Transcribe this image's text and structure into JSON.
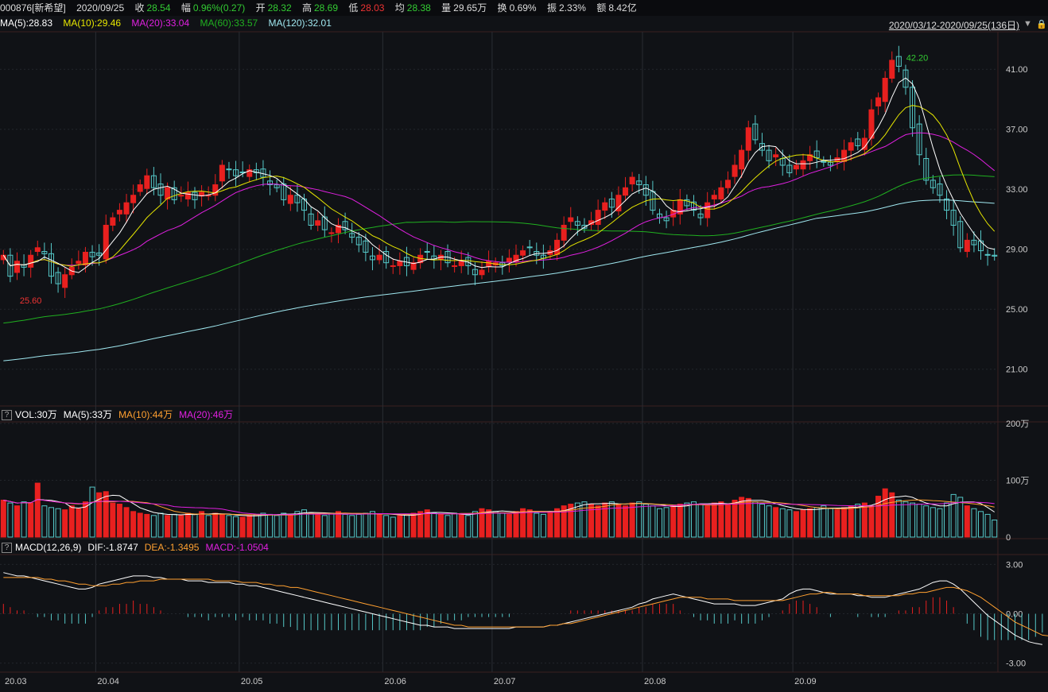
{
  "header": {
    "code_name": "000876[新希望]",
    "date": "2020/09/25",
    "close_label": "收",
    "close": "28.54",
    "change_label": "幅",
    "change": "0.96%(0.27)",
    "open_label": "开",
    "open": "28.32",
    "high_label": "高",
    "high": "28.69",
    "low_label": "低",
    "low": "28.03",
    "avg_label": "均",
    "avg": "28.38",
    "volume_label": "量",
    "volume": "29.65万",
    "turnover_label": "换",
    "turnover": "0.69%",
    "amplitude_label": "振",
    "amplitude": "2.33%",
    "amount_label": "额",
    "amount": "8.42亿"
  },
  "ma_legend": {
    "ma5": "MA(5):28.83",
    "ma10": "MA(10):29.46",
    "ma20": "MA(20):33.04",
    "ma60": "MA(60):33.57",
    "ma120": "MA(120):32.01"
  },
  "range_label": "2020/03/12-2020/09/25(136日)",
  "icons": [
    "dropdown-icon",
    "lock-icon"
  ],
  "vol_legend": {
    "help": "?",
    "vol": "VOL:30万",
    "ma5": "MA(5):33万",
    "ma10": "MA(10):44万",
    "ma20": "MA(20):46万"
  },
  "macd_legend": {
    "help": "?",
    "name": "MACD(12,26,9)",
    "dif": "DIF:-1.8747",
    "dea": "DEA:-1.3495",
    "macd": "MACD:-1.0504"
  },
  "colors": {
    "up": "#e8201f",
    "down": "#55c8c8",
    "ma5": "#ffffff",
    "ma10": "#e6e600",
    "ma20": "#e020e0",
    "ma60": "#20b020",
    "ma120": "#a0e8f0",
    "dif": "#ffffff",
    "dea": "#ffa030"
  },
  "chart_data": [
    {
      "type": "candlestick",
      "y_ticks": [
        "41.00",
        "37.00",
        "33.00",
        "29.00",
        "25.00",
        "21.00"
      ],
      "ylim": [
        19.5,
        43.5
      ],
      "max_label": "42.20",
      "min_label": "25.60",
      "x_ticks": [
        "20.03",
        "20.04",
        "20.05",
        "20.06",
        "20.07",
        "20.08",
        "20.09"
      ],
      "close": [
        28.6,
        27.2,
        28.2,
        27.8,
        28.6,
        29.1,
        28.7,
        27.2,
        26.7,
        27.3,
        27.8,
        28.2,
        28.8,
        28.5,
        28.6,
        30.6,
        31.1,
        31.6,
        32.1,
        32.6,
        33.3,
        33.9,
        33.1,
        32.6,
        33.1,
        32.3,
        32.6,
        32.8,
        32.3,
        32.8,
        32.6,
        33.3,
        34.6,
        34.3,
        33.9,
        34.1,
        34.3,
        34.1,
        33.8,
        33.3,
        33.1,
        32.3,
        32.6,
        32.1,
        31.6,
        30.6,
        30.9,
        30.3,
        30.1,
        30.6,
        30.3,
        29.8,
        29.3,
        28.8,
        28.3,
        28.6,
        28.1,
        27.9,
        28.2,
        27.9,
        28.1,
        28.6,
        28.8,
        28.3,
        28.6,
        28.1,
        27.9,
        28.2,
        27.9,
        27.3,
        27.6,
        28.2,
        28.1,
        27.9,
        28.4,
        28.6,
        28.9,
        29.1,
        28.6,
        28.4,
        28.9,
        29.6,
        30.6,
        31.1,
        30.6,
        30.4,
        30.9,
        31.6,
        32.1,
        31.8,
        32.6,
        33.1,
        33.8,
        33.3,
        32.6,
        31.6,
        31.1,
        30.9,
        31.6,
        32.3,
        31.9,
        31.6,
        31.1,
        32.1,
        32.6,
        33.1,
        33.6,
        34.6,
        35.6,
        37.1,
        36.3,
        35.6,
        34.9,
        35.3,
        34.6,
        34.1,
        34.6,
        34.9,
        35.3,
        35.1,
        34.8,
        34.6,
        35.1,
        35.6,
        36.1,
        35.9,
        36.4,
        38.3,
        39.1,
        40.4,
        41.6,
        41.2,
        39.8,
        37.1,
        35.3,
        33.6,
        33.1,
        32.6,
        31.6,
        30.6,
        29.1,
        29.6,
        29.3,
        28.9,
        28.6,
        28.54
      ],
      "volume_ylim": [
        0,
        200
      ],
      "volume_y_ticks": [
        "200万",
        "100万",
        "0"
      ],
      "volume": [
        65,
        60,
        55,
        62,
        60,
        95,
        55,
        52,
        50,
        48,
        55,
        50,
        62,
        88,
        78,
        80,
        60,
        58,
        52,
        45,
        42,
        40,
        38,
        42,
        38,
        40,
        38,
        42,
        40,
        45,
        38,
        42,
        40,
        38,
        36,
        35,
        38,
        40,
        42,
        40,
        38,
        42,
        40,
        45,
        48,
        42,
        40,
        38,
        42,
        45,
        40,
        38,
        40,
        42,
        45,
        40,
        38,
        35,
        38,
        40,
        42,
        45,
        48,
        42,
        40,
        38,
        42,
        40,
        38,
        45,
        50,
        48,
        45,
        42,
        40,
        45,
        50,
        48,
        42,
        40,
        45,
        50,
        55,
        58,
        60,
        62,
        58,
        55,
        60,
        62,
        58,
        55,
        60,
        62,
        58,
        55,
        50,
        52,
        55,
        58,
        60,
        62,
        58,
        55,
        60,
        62,
        58,
        65,
        70,
        68,
        62,
        58,
        55,
        52,
        50,
        48,
        45,
        48,
        50,
        52,
        55,
        50,
        48,
        52,
        55,
        58,
        60,
        55,
        72,
        85,
        78,
        65,
        62,
        60,
        58,
        55,
        52,
        50,
        60,
        75,
        70,
        55,
        50,
        45,
        40,
        30
      ],
      "macd_ylim": [
        -3.5,
        3.5
      ],
      "macd_y_ticks": [
        "3.00",
        "0.00",
        "-3.00"
      ],
      "dif": [
        2.5,
        2.4,
        2.3,
        2.3,
        2.2,
        2.1,
        2.0,
        1.9,
        1.8,
        1.7,
        1.6,
        1.5,
        1.5,
        1.6,
        1.8,
        1.9,
        2.0,
        2.1,
        2.2,
        2.3,
        2.3,
        2.3,
        2.2,
        2.2,
        2.1,
        2.1,
        2.1,
        2.0,
        2.0,
        2.0,
        1.9,
        1.9,
        1.9,
        1.9,
        1.8,
        1.8,
        1.7,
        1.7,
        1.6,
        1.5,
        1.4,
        1.3,
        1.2,
        1.1,
        1.0,
        0.9,
        0.8,
        0.7,
        0.6,
        0.5,
        0.4,
        0.3,
        0.2,
        0.1,
        0.0,
        -0.1,
        -0.2,
        -0.3,
        -0.4,
        -0.5,
        -0.6,
        -0.7,
        -0.7,
        -0.8,
        -0.8,
        -0.8,
        -0.9,
        -0.9,
        -0.9,
        -0.9,
        -0.9,
        -0.9,
        -0.9,
        -0.9,
        -0.9,
        -0.8,
        -0.8,
        -0.8,
        -0.8,
        -0.8,
        -0.7,
        -0.7,
        -0.6,
        -0.5,
        -0.4,
        -0.3,
        -0.2,
        -0.1,
        0.0,
        0.1,
        0.2,
        0.3,
        0.4,
        0.6,
        0.7,
        0.9,
        1.0,
        1.1,
        1.2,
        1.1,
        1.0,
        0.9,
        0.8,
        0.7,
        0.6,
        0.6,
        0.6,
        0.6,
        0.5,
        0.5,
        0.5,
        0.6,
        0.7,
        0.8,
        0.9,
        1.2,
        1.4,
        1.5,
        1.5,
        1.4,
        1.3,
        1.2,
        1.2,
        1.2,
        1.2,
        1.1,
        1.1,
        1.0,
        1.0,
        1.0,
        1.1,
        1.2,
        1.3,
        1.4,
        1.5,
        1.7,
        1.9,
        2.0,
        2.0,
        1.8,
        1.5,
        1.1,
        0.7,
        0.3,
        -0.1,
        -0.4,
        -0.7,
        -1.0,
        -1.3,
        -1.5,
        -1.7,
        -1.8,
        -1.87
      ],
      "dea": [
        2.2,
        2.2,
        2.2,
        2.2,
        2.2,
        2.2,
        2.1,
        2.1,
        2.0,
        2.0,
        1.9,
        1.8,
        1.8,
        1.7,
        1.7,
        1.7,
        1.8,
        1.8,
        1.9,
        1.9,
        2.0,
        2.0,
        2.0,
        2.1,
        2.1,
        2.1,
        2.1,
        2.1,
        2.1,
        2.1,
        2.1,
        2.0,
        2.0,
        2.0,
        2.0,
        1.9,
        1.9,
        1.9,
        1.8,
        1.8,
        1.7,
        1.7,
        1.6,
        1.6,
        1.5,
        1.4,
        1.3,
        1.2,
        1.1,
        1.0,
        0.9,
        0.8,
        0.7,
        0.6,
        0.5,
        0.4,
        0.3,
        0.2,
        0.1,
        0.0,
        -0.1,
        -0.2,
        -0.3,
        -0.4,
        -0.5,
        -0.6,
        -0.7,
        -0.7,
        -0.8,
        -0.8,
        -0.8,
        -0.8,
        -0.8,
        -0.8,
        -0.8,
        -0.8,
        -0.8,
        -0.8,
        -0.8,
        -0.8,
        -0.7,
        -0.7,
        -0.6,
        -0.6,
        -0.5,
        -0.4,
        -0.3,
        -0.2,
        -0.1,
        0.0,
        0.1,
        0.2,
        0.3,
        0.4,
        0.5,
        0.6,
        0.7,
        0.8,
        0.9,
        1.0,
        1.0,
        1.0,
        1.0,
        0.9,
        0.9,
        0.9,
        0.9,
        0.8,
        0.8,
        0.8,
        0.8,
        0.8,
        0.8,
        0.8,
        0.8,
        0.9,
        1.0,
        1.1,
        1.2,
        1.2,
        1.3,
        1.3,
        1.2,
        1.2,
        1.2,
        1.2,
        1.1,
        1.1,
        1.1,
        1.1,
        1.1,
        1.1,
        1.2,
        1.2,
        1.3,
        1.3,
        1.4,
        1.5,
        1.6,
        1.6,
        1.5,
        1.4,
        1.2,
        1.0,
        0.7,
        0.4,
        0.1,
        -0.2,
        -0.5,
        -0.7,
        -0.9,
        -1.1,
        -1.3,
        -1.35
      ]
    }
  ]
}
